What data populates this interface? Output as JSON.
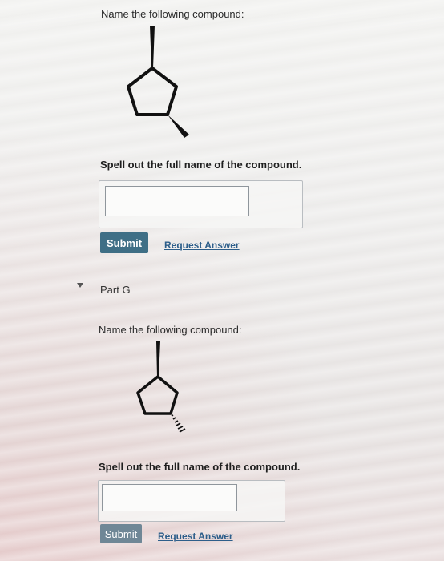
{
  "question1": {
    "prompt": "Name the following compound:",
    "instruction": "Spell out the full name of the compound.",
    "answer_value": "",
    "submit_label": "Submit",
    "request_label": "Request Answer"
  },
  "part_g": {
    "label": "Part G",
    "prompt": "Name the following compound:",
    "instruction": "Spell out the full name of the compound.",
    "answer_value": "",
    "submit_label": "Submit",
    "request_label": "Request Answer"
  },
  "colors": {
    "submit_button": "#3f6f86",
    "link": "#2d5e8a"
  },
  "icons": {
    "collapse_caret": "triangle-down"
  }
}
